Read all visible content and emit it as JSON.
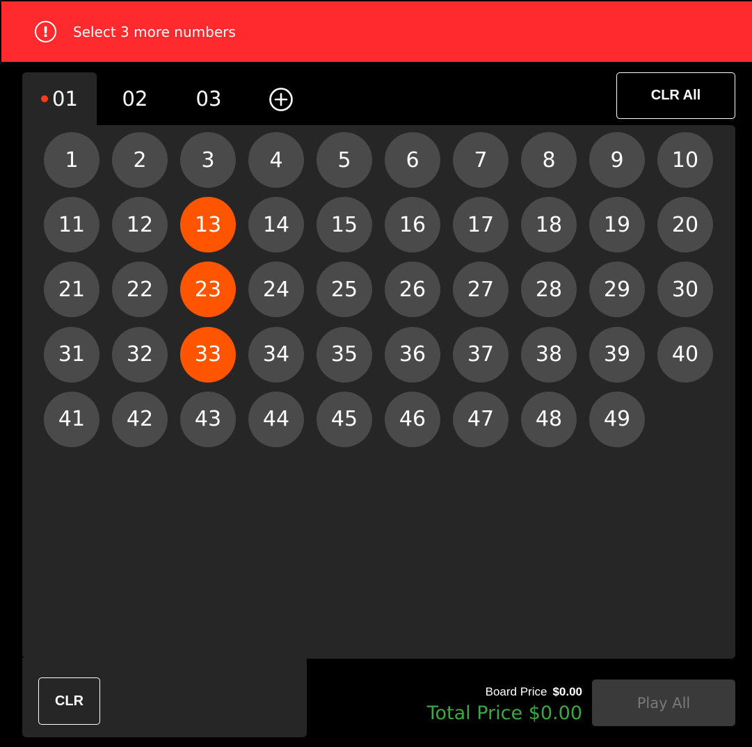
{
  "alert": {
    "icon": "alert-circle-icon",
    "message": "Select 3 more numbers",
    "color": "#ff2a2e"
  },
  "tabs": [
    {
      "label": "01",
      "active": true,
      "has_indicator": true
    },
    {
      "label": "02",
      "active": false
    },
    {
      "label": "03",
      "active": false
    }
  ],
  "add_tab_icon": "plus-circle-icon",
  "clr_all_label": "CLR All",
  "board": {
    "numbers": [
      1,
      2,
      3,
      4,
      5,
      6,
      7,
      8,
      9,
      10,
      11,
      12,
      13,
      14,
      15,
      16,
      17,
      18,
      19,
      20,
      21,
      22,
      23,
      24,
      25,
      26,
      27,
      28,
      29,
      30,
      31,
      32,
      33,
      34,
      35,
      36,
      37,
      38,
      39,
      40,
      41,
      42,
      43,
      44,
      45,
      46,
      47,
      48,
      49
    ],
    "selected": [
      13,
      23,
      33
    ],
    "selected_color": "#ff5500",
    "unselected_color": "#4a4a4a"
  },
  "clr_label": "CLR",
  "pricing": {
    "board_price_label": "Board Price",
    "board_price_value": "$0.00",
    "total_price_text": "Total Price $0.00",
    "total_color": "#3aa845"
  },
  "play_all_label": "Play All"
}
